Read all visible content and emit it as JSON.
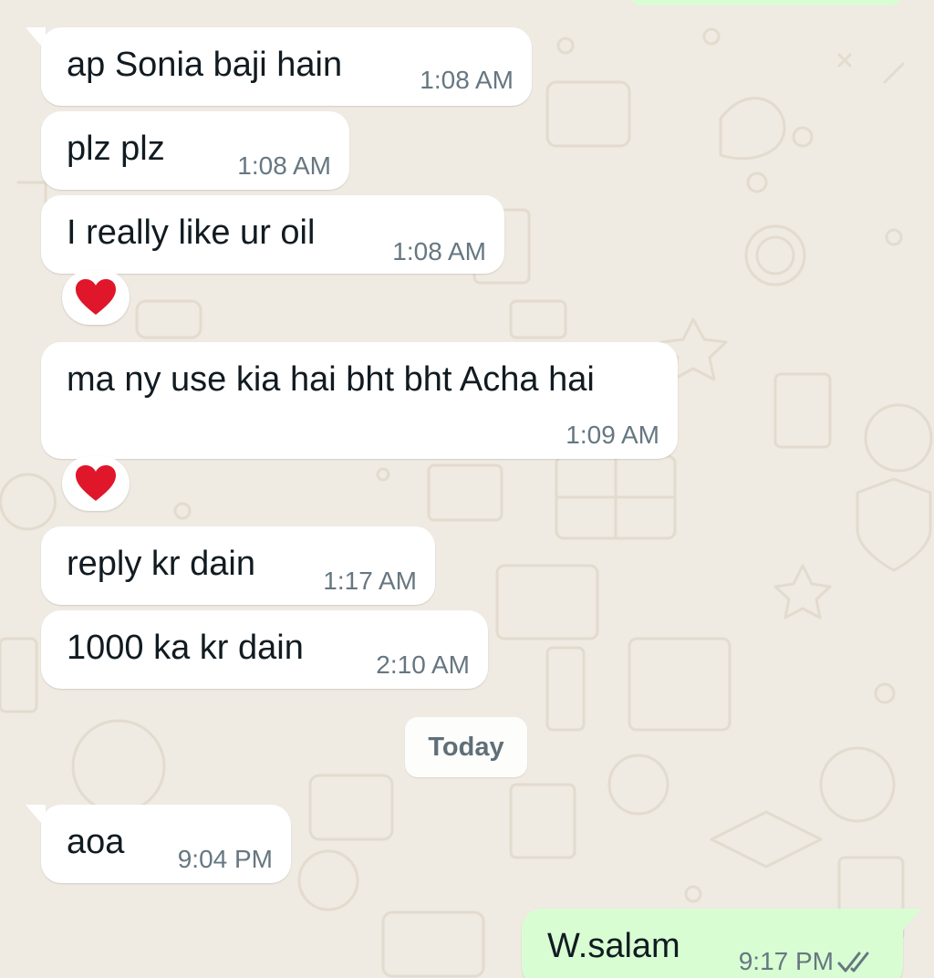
{
  "messages": [
    {
      "text": "ap Sonia baji hain",
      "time": "1:08 AM"
    },
    {
      "text": "plz  plz",
      "time": "1:08 AM"
    },
    {
      "text": "I really like ur oil",
      "time": "1:08 AM",
      "reaction": "heart"
    },
    {
      "text": "ma ny use kia hai bht bht Acha hai",
      "time": "1:09 AM",
      "reaction": "heart"
    },
    {
      "text": "reply kr dain",
      "time": "1:17 AM"
    },
    {
      "text": "1000 ka kr dain",
      "time": "2:10 AM"
    },
    {
      "text": "aoa",
      "time": "9:04 PM"
    },
    {
      "text": "W.salam",
      "time": "9:17 PM",
      "status": "read"
    }
  ],
  "date_separator": "Today",
  "colors": {
    "background": "#efeae2",
    "incoming_bubble": "#ffffff",
    "outgoing_bubble": "#d9fdd3",
    "time_text": "#667781",
    "read_ticks": "#667781",
    "heart": "#e0162b"
  }
}
